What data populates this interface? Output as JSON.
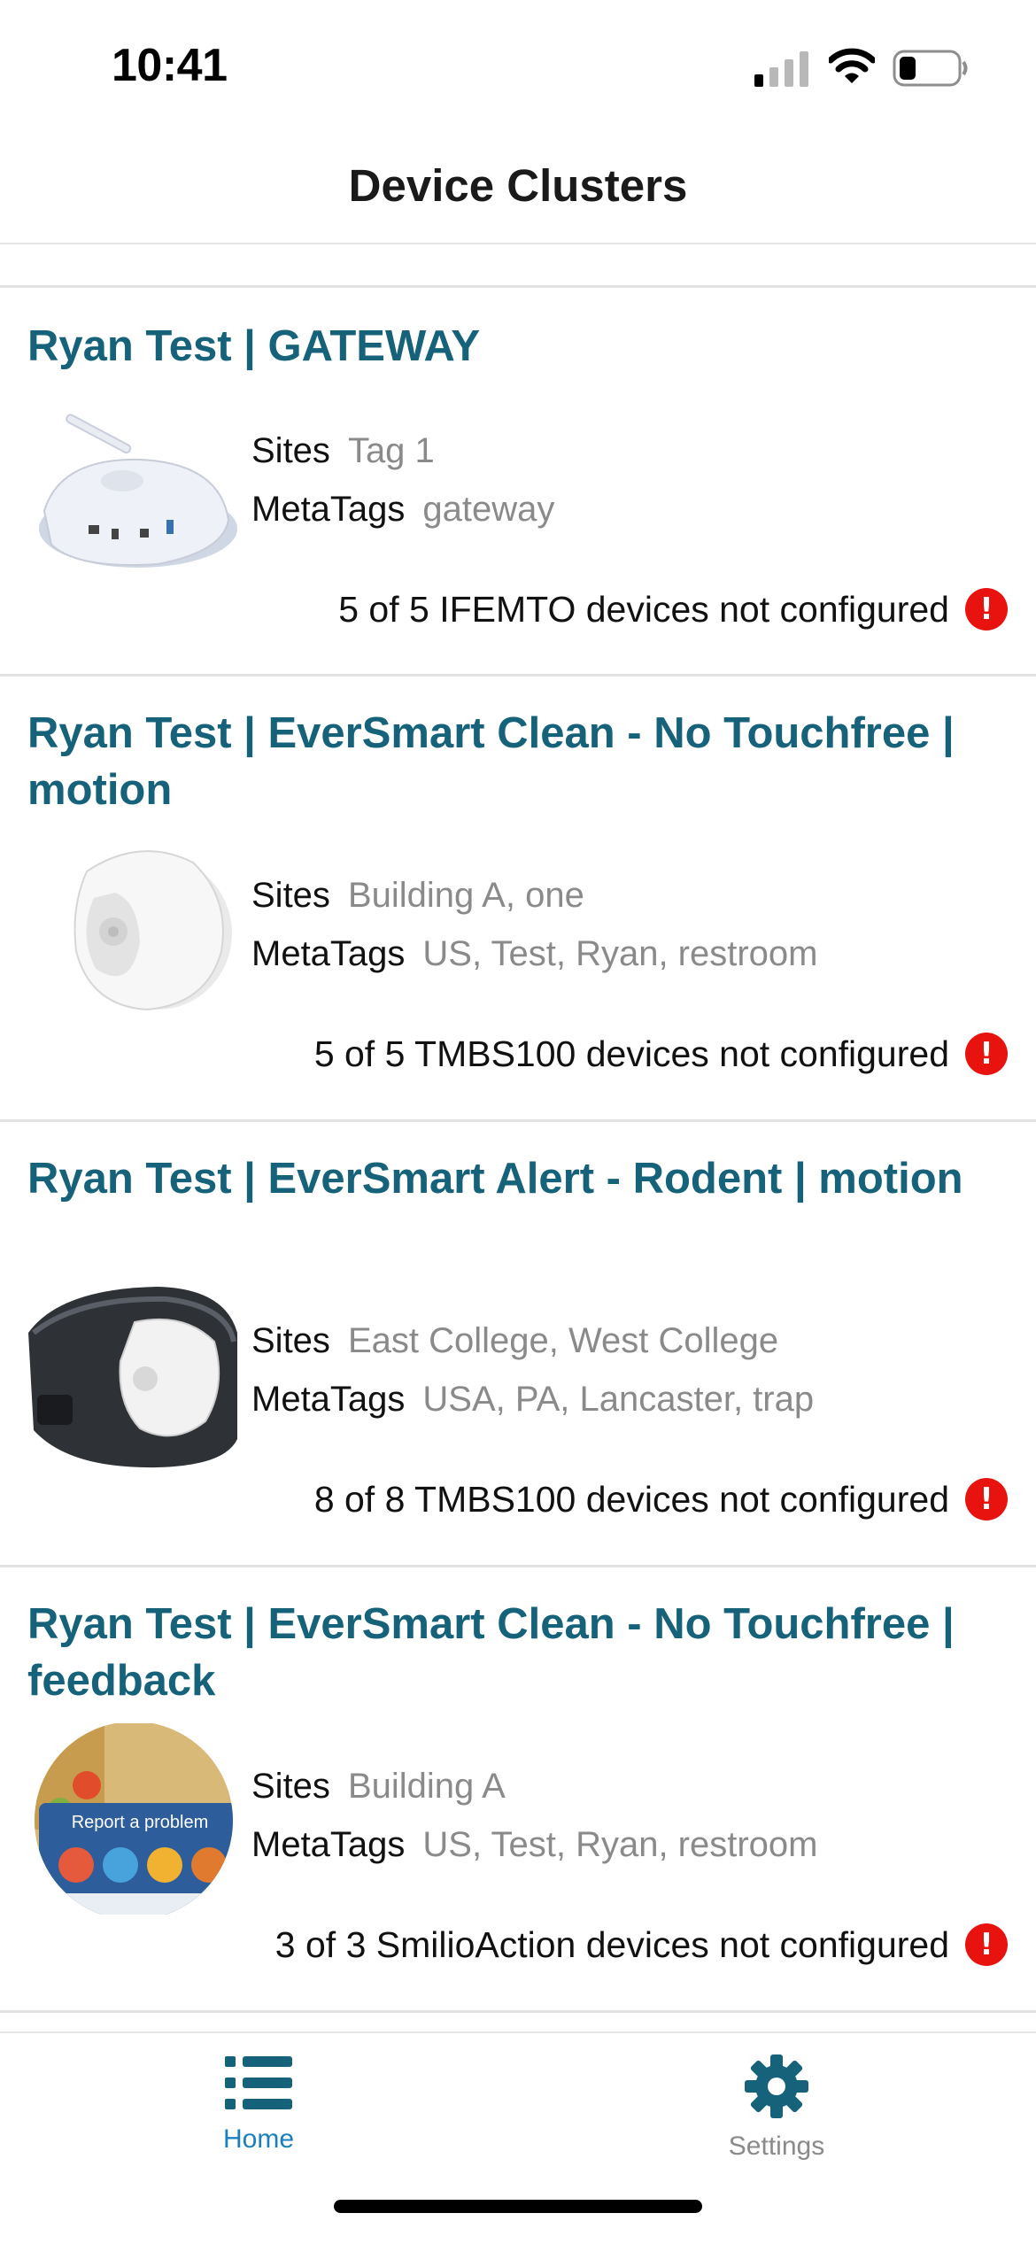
{
  "status_bar": {
    "time": "10:41",
    "icons": [
      "signal-icon",
      "wifi-icon",
      "battery-icon"
    ]
  },
  "header": {
    "title": "Device Clusters"
  },
  "colors": {
    "title": "#15627a",
    "alert": "#e8130f",
    "tab_active": "#1a7fbf",
    "tab_inactive": "#8a8a8a"
  },
  "clusters": [
    {
      "title": "Ryan Test | GATEWAY",
      "image": "gateway-device-image",
      "sites_label": "Sites",
      "sites": "Tag 1",
      "metatags_label": "MetaTags",
      "metatags": "gateway",
      "status": "5 of 5 IFEMTO devices not configured",
      "alert_icon": "!"
    },
    {
      "title": "Ryan Test | EverSmart Clean - No Touchfree | motion",
      "image": "motion-sensor-image",
      "sites_label": "Sites",
      "sites": "Building A, one",
      "metatags_label": "MetaTags",
      "metatags": "US, Test, Ryan, restroom",
      "status": "5 of 5 TMBS100 devices not configured",
      "alert_icon": "!"
    },
    {
      "title": "Ryan Test | EverSmart Alert - Rodent | motion",
      "image": "rodent-trap-image",
      "sites_label": "Sites",
      "sites": "East College, West College",
      "metatags_label": "MetaTags",
      "metatags": "USA,  PA,  Lancaster, trap",
      "status": "8 of 8 TMBS100 devices not configured",
      "alert_icon": "!"
    },
    {
      "title": "Ryan Test | EverSmart Clean - No Touchfree | feedback",
      "image": "feedback-panel-image",
      "image_text": "Report a problem",
      "sites_label": "Sites",
      "sites": "Building A",
      "metatags_label": "MetaTags",
      "metatags": "US, Test, Ryan, restroom",
      "status": "3 of 3 SmilioAction devices not configured",
      "alert_icon": "!"
    }
  ],
  "tabs": [
    {
      "label": "Home",
      "icon": "list-icon",
      "active": true
    },
    {
      "label": "Settings",
      "icon": "gear-icon",
      "active": false
    }
  ]
}
